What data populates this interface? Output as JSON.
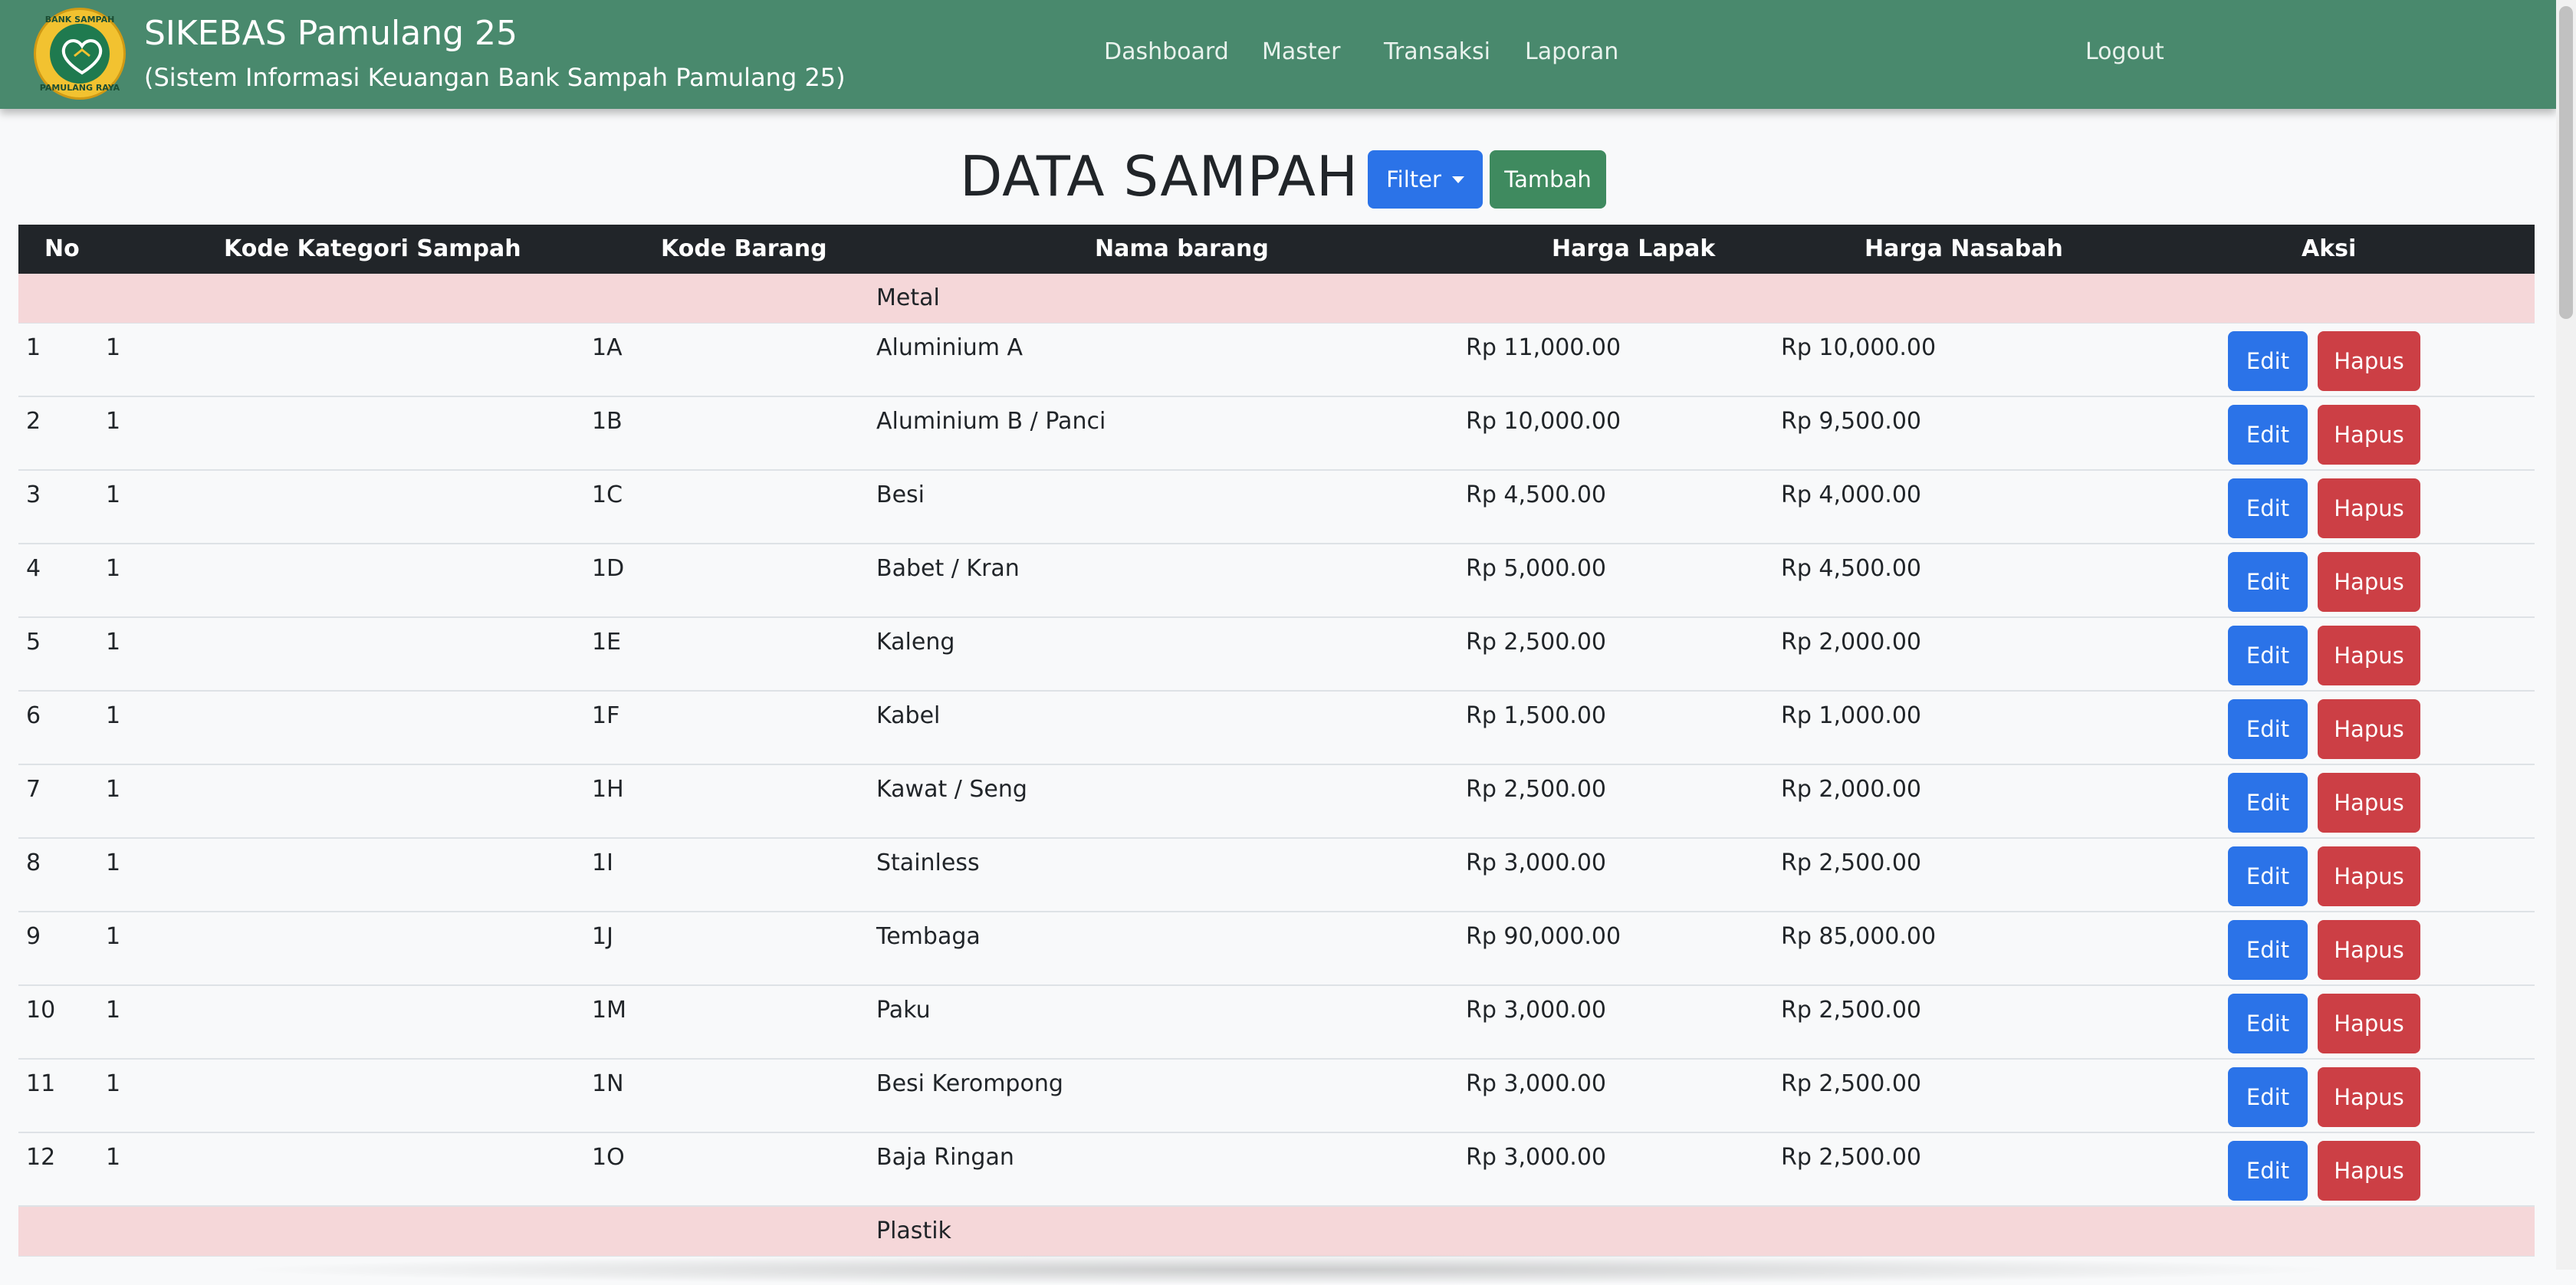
{
  "navbar": {
    "brand_title": "SIKEBAS Pamulang 25",
    "brand_subtitle": "(Sistem Informasi Keuangan Bank Sampah Pamulang 25)",
    "logo": {
      "top_text": "BANK SAMPAH",
      "bottom_text": "PAMULANG RAYA"
    },
    "links": [
      "Dashboard",
      "Master",
      "Transaksi",
      "Laporan"
    ],
    "logout_label": "Logout"
  },
  "page": {
    "title": "DATA SAMPAH",
    "filter_label": "Filter",
    "add_label": "Tambah"
  },
  "table": {
    "headers": [
      "No",
      "Kode Kategori Sampah",
      "Kode Barang",
      "Nama barang",
      "Harga Lapak",
      "Harga Nasabah",
      "Aksi"
    ],
    "categories": [
      "Metal",
      "Plastik"
    ],
    "edit_label": "Edit",
    "delete_label": "Hapus",
    "rows": [
      {
        "no": "1",
        "kategori": "1",
        "kode": "1A",
        "nama": "Aluminium A",
        "lapak": "Rp 11,000.00",
        "nasabah": "Rp 10,000.00"
      },
      {
        "no": "2",
        "kategori": "1",
        "kode": "1B",
        "nama": "Aluminium B / Panci",
        "lapak": "Rp 10,000.00",
        "nasabah": "Rp 9,500.00"
      },
      {
        "no": "3",
        "kategori": "1",
        "kode": "1C",
        "nama": "Besi",
        "lapak": "Rp 4,500.00",
        "nasabah": "Rp 4,000.00"
      },
      {
        "no": "4",
        "kategori": "1",
        "kode": "1D",
        "nama": "Babet / Kran",
        "lapak": "Rp 5,000.00",
        "nasabah": "Rp 4,500.00"
      },
      {
        "no": "5",
        "kategori": "1",
        "kode": "1E",
        "nama": "Kaleng",
        "lapak": "Rp 2,500.00",
        "nasabah": "Rp 2,000.00"
      },
      {
        "no": "6",
        "kategori": "1",
        "kode": "1F",
        "nama": "Kabel",
        "lapak": "Rp 1,500.00",
        "nasabah": "Rp 1,000.00"
      },
      {
        "no": "7",
        "kategori": "1",
        "kode": "1H",
        "nama": "Kawat / Seng",
        "lapak": "Rp 2,500.00",
        "nasabah": "Rp 2,000.00"
      },
      {
        "no": "8",
        "kategori": "1",
        "kode": "1I",
        "nama": "Stainless",
        "lapak": "Rp 3,000.00",
        "nasabah": "Rp 2,500.00"
      },
      {
        "no": "9",
        "kategori": "1",
        "kode": "1J",
        "nama": "Tembaga",
        "lapak": "Rp 90,000.00",
        "nasabah": "Rp 85,000.00"
      },
      {
        "no": "10",
        "kategori": "1",
        "kode": "1M",
        "nama": "Paku",
        "lapak": "Rp 3,000.00",
        "nasabah": "Rp 2,500.00"
      },
      {
        "no": "11",
        "kategori": "1",
        "kode": "1N",
        "nama": "Besi Kerompong",
        "lapak": "Rp 3,000.00",
        "nasabah": "Rp 2,500.00"
      },
      {
        "no": "12",
        "kategori": "1",
        "kode": "1O",
        "nama": "Baja Ringan",
        "lapak": "Rp 3,000.00",
        "nasabah": "Rp 2,500.00"
      }
    ]
  },
  "colors": {
    "navbar": "#49896d",
    "primary": "#2b73e8",
    "success": "#3f8a5f",
    "danger": "#cc3f45",
    "table_header": "#212529",
    "category_row": "#f5d7d9"
  }
}
